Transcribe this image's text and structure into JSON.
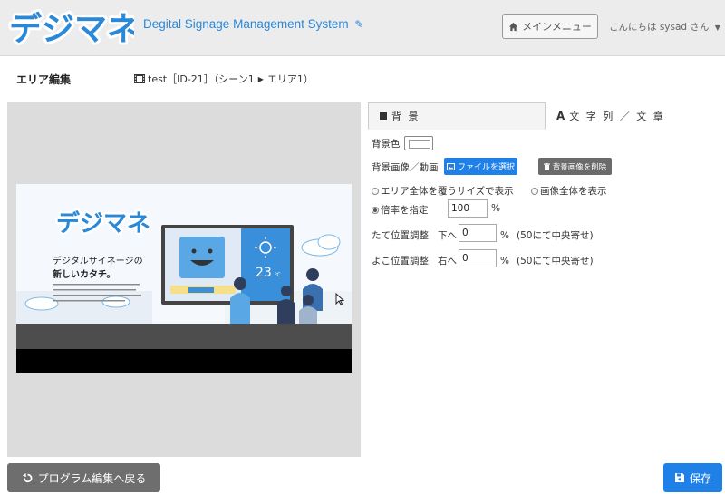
{
  "header": {
    "logo_text": "デジマネ",
    "app_title": "Degital Signage Management System",
    "main_menu_label": "メインメニュー",
    "user_greeting": "こんにちは sysad さん"
  },
  "page": {
    "title": "エリア編集",
    "breadcrumb_program": "test［ID-21］（シーン1",
    "breadcrumb_area": "エリア1）"
  },
  "preview": {
    "logo_text": "デジマネ",
    "tagline_line1": "デジタルサイネージの",
    "tagline_line2": "新しいカタチ。",
    "weather_temp": "23",
    "weather_unit": "℃"
  },
  "tabs": [
    {
      "label": "背 景",
      "icon": "square-icon"
    },
    {
      "label": "文 字 列 ／ 文 章",
      "icon": "font-icon"
    }
  ],
  "background_tab": {
    "bg_color_label": "背景色",
    "bg_color_value": "#ffffff",
    "bg_media_label": "背景画像／動画",
    "choose_file_label": "ファイルを選択",
    "delete_bg_label": "背景画像を削除",
    "fit_area_label": "エリア全体を覆うサイズで表示",
    "fit_image_label": "画像全体を表示",
    "scale_label": "倍率を指定",
    "scale_value": "100",
    "scale_unit": "%",
    "vpos_label": "たて位置調整",
    "vpos_direction": "下へ",
    "vpos_value": "0",
    "vpos_unit": "%",
    "vpos_hint": "(50にて中央寄せ)",
    "hpos_label": "よこ位置調整",
    "hpos_direction": "右へ",
    "hpos_value": "0",
    "hpos_unit": "%",
    "hpos_hint": "(50にて中央寄せ)"
  },
  "footer": {
    "back_label": "プログラム編集へ戻る",
    "save_label": "保存"
  },
  "colors": {
    "accent": "#1f80e8",
    "gray_button": "#6e6e6e",
    "logo_blue": "#2a88d8"
  }
}
